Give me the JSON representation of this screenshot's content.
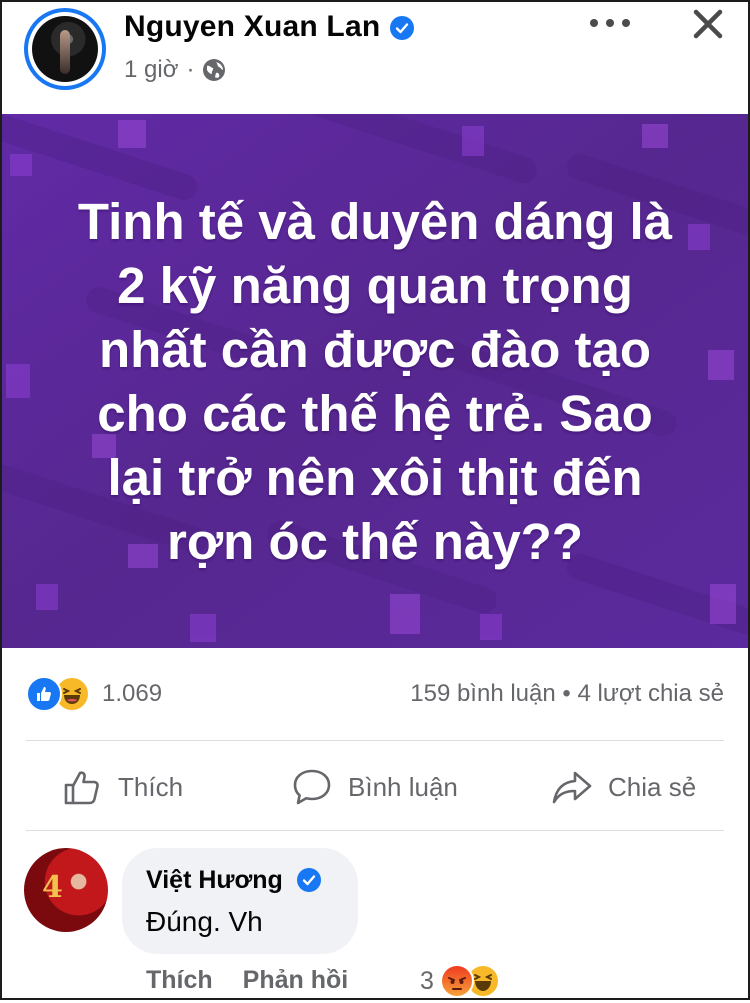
{
  "post": {
    "author": "Nguyen Xuan Lan",
    "time": "1 giờ",
    "separator": "·",
    "text_lines": [
      "Tinh tế và duyên dáng là",
      "2 kỹ năng quan trọng",
      "nhất cần được đào tạo",
      "cho các thế hệ trẻ. Sao",
      "lại trở nên xôi thịt đến",
      "rợn óc thế này??"
    ],
    "background_color": "#5a2a9c"
  },
  "reactions": {
    "count": "1.069",
    "icons": [
      "like-icon",
      "haha-icon"
    ]
  },
  "stats": {
    "comments": "159 bình luận",
    "dot": "•",
    "shares": "4 lượt chia sẻ"
  },
  "actions": {
    "like": "Thích",
    "comment": "Bình luận",
    "share": "Chia sẻ"
  },
  "comment": {
    "author": "Việt Hương",
    "text": "Đúng. Vh",
    "like": "Thích",
    "reply": "Phản hồi",
    "reaction_count": "3",
    "avatar_badge": "4"
  },
  "colors": {
    "accent": "#1877f2",
    "muted_text": "#65676b",
    "bubble": "#f0f2f5"
  }
}
